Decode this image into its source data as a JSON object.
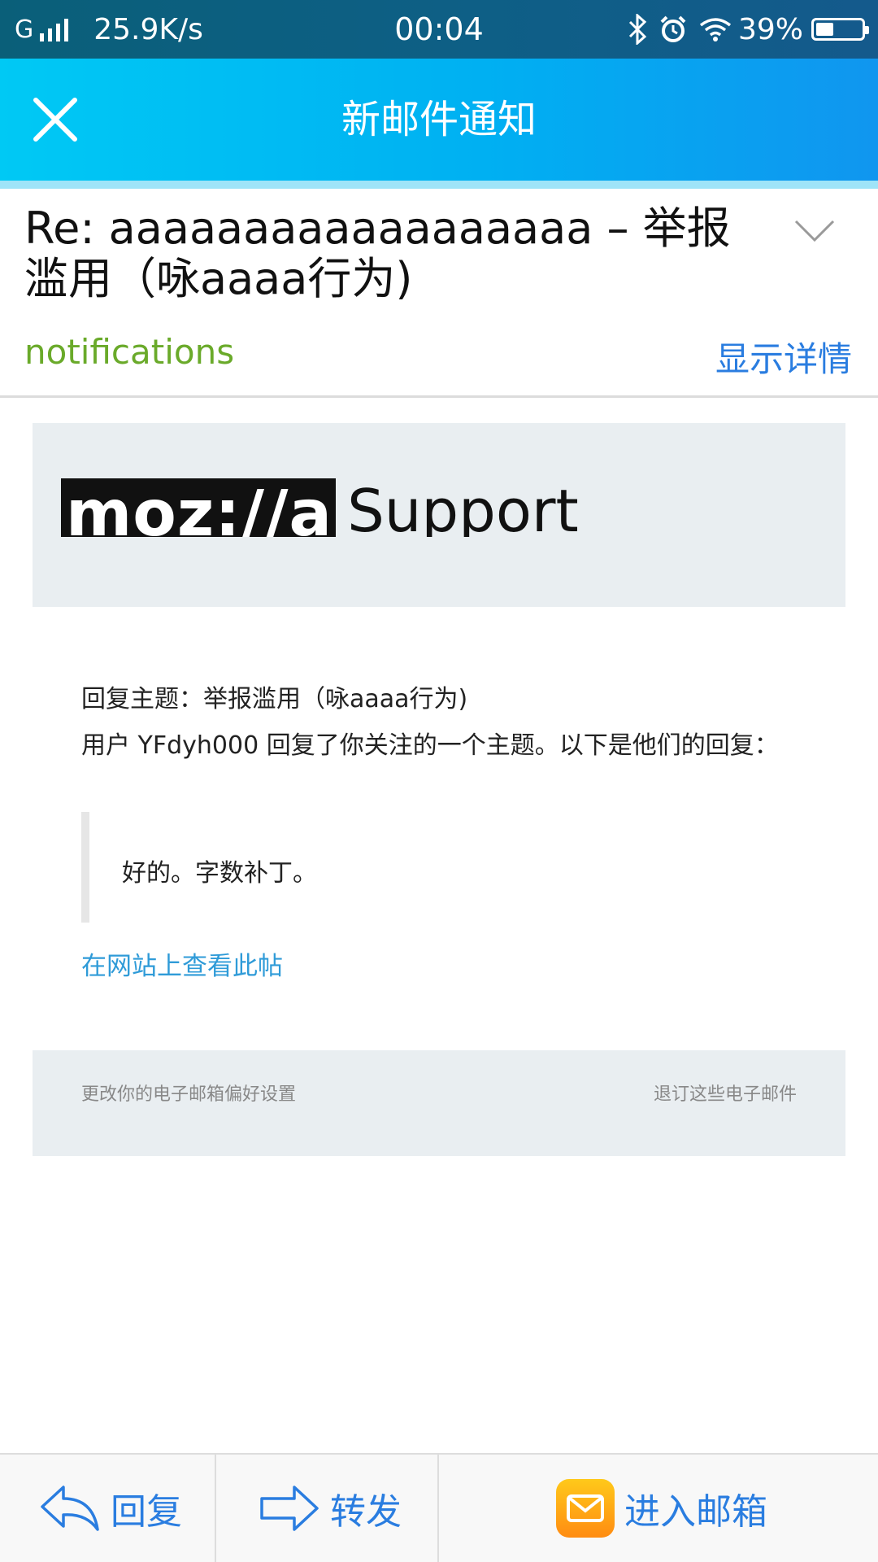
{
  "status_bar": {
    "network_type": "G",
    "speed": "25.9K/s",
    "time": "00:04",
    "battery": "39%",
    "battery_level": 0.39,
    "icons": [
      "signal-icon",
      "bluetooth-icon",
      "alarm-icon",
      "wifi-icon",
      "battery-icon"
    ]
  },
  "header": {
    "title": "新邮件通知",
    "close_icon": "close-icon",
    "background": "#00b0f2"
  },
  "email": {
    "subject": "Re: aaaaaaaaaaaaaaaaaa – 举报滥用（咏aaaa行为)",
    "sender": "notifications",
    "show_details": "显示详情",
    "expand_icon": "chevron-down-icon",
    "sender_color": "#6aaa2a",
    "link_color": "#2a7de0"
  },
  "body": {
    "logo_text": "moz://a",
    "logo_suffix": "Support",
    "reply_subject": "回复主题：举报滥用（咏aaaa行为)",
    "reply_intro": "用户 YFdyh000 回复了你关注的一个主题。以下是他们的回复：",
    "quote": "好的。字数补丁。",
    "view_link": "在网站上查看此帖",
    "footer_pref": "更改你的电子邮箱偏好设置",
    "footer_unsubscribe": "退订这些电子邮件"
  },
  "toolbar": {
    "reply": "回复",
    "forward": "转发",
    "inbox": "进入邮箱",
    "icons": [
      "reply-arrow-icon",
      "forward-arrow-icon",
      "mail-app-icon"
    ]
  }
}
